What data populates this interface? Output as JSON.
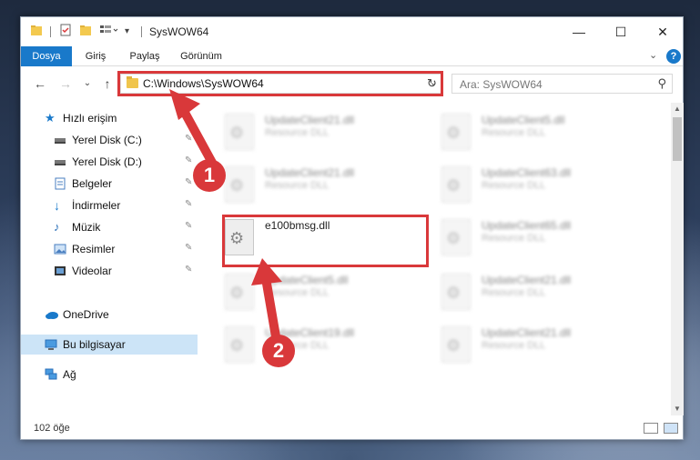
{
  "window": {
    "title": "SysWOW64",
    "controls": {
      "minimize": "—",
      "maximize": "☐",
      "close": "✕"
    }
  },
  "ribbon": {
    "tabs": [
      "Dosya",
      "Giriş",
      "Paylaş",
      "Görünüm"
    ],
    "expand": "⌄",
    "help": "?"
  },
  "navbar": {
    "back": "←",
    "forward": "→",
    "recent": "⌄",
    "up": "↑",
    "address": "C:\\Windows\\SysWOW64",
    "address_dropdown": "⌄",
    "refresh": "↻",
    "search_placeholder": "Ara: SysWOW64",
    "search_icon": "⚲"
  },
  "sidebar": {
    "items": [
      {
        "label": "Hızlı erişim",
        "icon": "star-icon",
        "pinned": false
      },
      {
        "label": "Yerel Disk (C:)",
        "icon": "drive-icon",
        "pinned": true
      },
      {
        "label": "Yerel Disk (D:)",
        "icon": "drive-icon",
        "pinned": true
      },
      {
        "label": "Belgeler",
        "icon": "documents-icon",
        "pinned": true
      },
      {
        "label": "İndirmeler",
        "icon": "download-icon",
        "pinned": true
      },
      {
        "label": "Müzik",
        "icon": "music-icon",
        "pinned": true
      },
      {
        "label": "Resimler",
        "icon": "pictures-icon",
        "pinned": true
      },
      {
        "label": "Videolar",
        "icon": "video-icon",
        "pinned": true
      },
      {
        "label": "OneDrive",
        "icon": "cloud-icon",
        "pinned": false
      },
      {
        "label": "Bu bilgisayar",
        "icon": "computer-icon",
        "pinned": false,
        "selected": true
      },
      {
        "label": "Ağ",
        "icon": "network-icon",
        "pinned": false
      }
    ],
    "pin_glyph": "📌"
  },
  "files": [
    {
      "name": "UpdateClient21.dll",
      "type": "Resource DLL",
      "blurred": true
    },
    {
      "name": "UpdateClient5.dll",
      "type": "Resource DLL",
      "blurred": true
    },
    {
      "name": "UpdateClient21.dll",
      "type": "Resource DLL",
      "blurred": true
    },
    {
      "name": "UpdateClient63.dll",
      "type": "Resource DLL",
      "blurred": true
    },
    {
      "name": "e100bmsg.dll",
      "type": "",
      "blurred": false
    },
    {
      "name": "UpdateClient65.dll",
      "type": "Resource DLL",
      "blurred": true
    },
    {
      "name": "UpdateClient5.dll",
      "type": "Resource DLL",
      "blurred": true
    },
    {
      "name": "UpdateClient21.dll",
      "type": "Resource DLL",
      "blurred": true
    },
    {
      "name": "UpdateClient19.dll",
      "type": "Resource DLL",
      "blurred": true
    },
    {
      "name": "UpdateClient21.dll",
      "type": "Resource DLL",
      "blurred": true
    }
  ],
  "status": {
    "item_count": "102 öğe"
  },
  "callouts": {
    "step1": "1",
    "step2": "2"
  },
  "colors": {
    "accent": "#1979ca",
    "highlight": "#d9383a",
    "selected": "#cce4f7"
  }
}
